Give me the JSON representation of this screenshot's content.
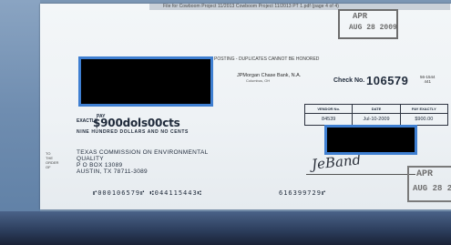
{
  "header": {
    "strip_text": "File for Cowboom Project 11/2013 Cowboom Project 11/2013 PT 1.pdf (page 4 of 4)"
  },
  "stamps": {
    "top": {
      "line1": "APR",
      "line2": "AUG 28 2009"
    },
    "bottom": {
      "line1": "APR",
      "line2": "AUG 28 2"
    }
  },
  "check": {
    "posting_notice": "POSTING - DUPLICATES CANNOT BE HONORED",
    "bank_name": "JPMorgan Chase Bank, N.A.",
    "bank_city": "Columbus, OH",
    "check_no_label": "Check No.",
    "check_no": "106579",
    "routing": [
      "56-1544",
      "441"
    ],
    "grid": [
      {
        "header": "VENDOR No.",
        "value": "84539"
      },
      {
        "header": "DATE",
        "value": "Jul-10-2009"
      },
      {
        "header": "PAY EXACTLY",
        "value": "$900.00"
      }
    ],
    "pay_label_line1": "PAY",
    "pay_label_line2": "EXACTLY",
    "pay_amount": "$900dols00cts",
    "amount_words": "NINE HUNDRED DOLLARS AND NO CENTS",
    "to_order": [
      "TO",
      "THE",
      "ORDER",
      "OF"
    ],
    "payee": {
      "line1": "TEXAS COMMISSION ON ENVIRONMENTAL",
      "line2": "QUALITY",
      "line3": "P O BOX 13089",
      "line4": "AUSTIN, TX  78711-3089"
    },
    "signature": "JeBand",
    "micr_left": "⑈000106579⑈ ⑆044115443⑆",
    "micr_right": "616399729⑈"
  }
}
